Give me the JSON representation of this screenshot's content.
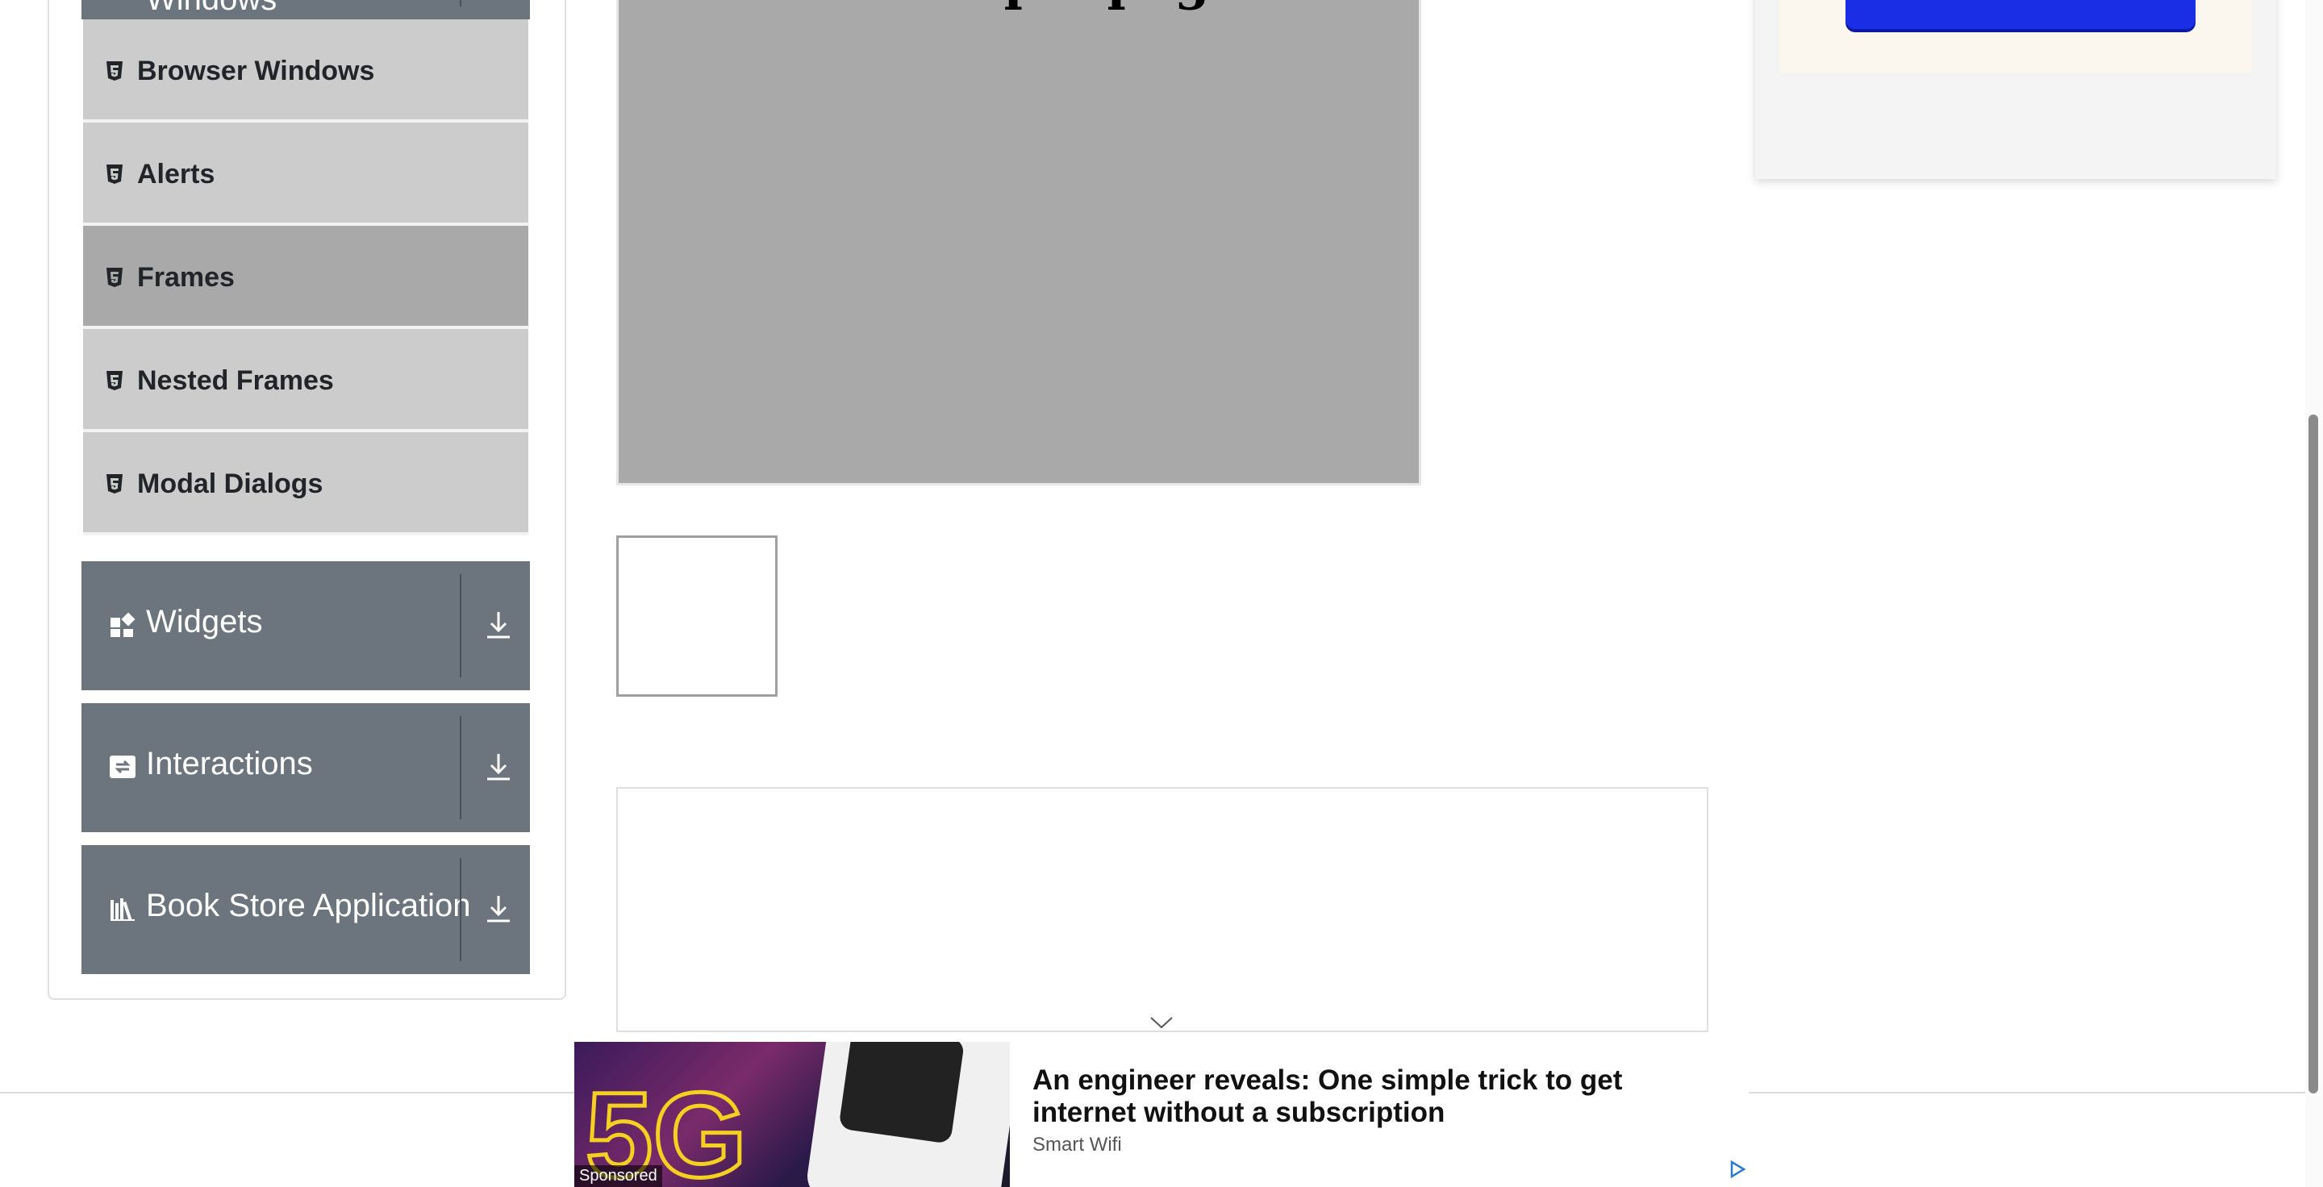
{
  "sidebar": {
    "top_group_label": "Windows",
    "menu_items": [
      {
        "label": "Browser Windows",
        "icon": "html5-icon"
      },
      {
        "label": "Alerts",
        "icon": "html5-icon"
      },
      {
        "label": "Frames",
        "icon": "html5-icon",
        "active": true
      },
      {
        "label": "Nested Frames",
        "icon": "html5-icon"
      },
      {
        "label": "Modal Dialogs",
        "icon": "html5-icon"
      }
    ],
    "groups": [
      {
        "label": "Widgets",
        "icon": "widgets-icon"
      },
      {
        "label": "Interactions",
        "icon": "interactions-icon"
      },
      {
        "label": "Book Store Application",
        "icon": "books-icon"
      }
    ]
  },
  "main": {
    "frame1_text": "This is a sample page"
  },
  "sponsored_ad": {
    "badge": "Sponsored",
    "image_text": "5G",
    "headline": "An engineer reveals: One simple trick to get internet without a subscription",
    "source": "Smart Wifi"
  },
  "colors": {
    "group_header": "#6c757d",
    "menu_item": "#cccccc",
    "menu_item_active": "#a9a9a9",
    "frame_bg": "#a9a9a9"
  }
}
